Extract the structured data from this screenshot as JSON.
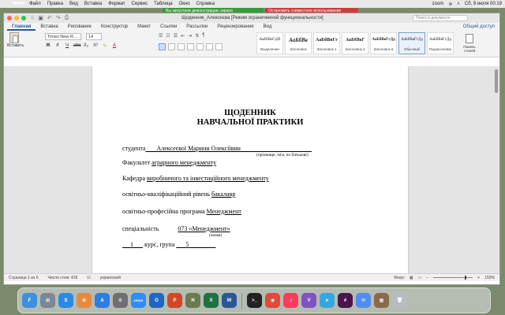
{
  "menubar": {
    "app_name": "Word",
    "items": [
      "Файл",
      "Правка",
      "Вид",
      "Вставка",
      "Формат",
      "Сервис",
      "Таблица",
      "Окно",
      "Справка"
    ],
    "zoom_label": "zoom",
    "clock": "Сб, 8 июля 00:19"
  },
  "banners": {
    "demo": "Вы запустили демонстрацию экрана",
    "stop": "Остановить совместное использование"
  },
  "window": {
    "title": "Щоденник_Алексеєва [Режим ограниченной функциональности]",
    "search_placeholder": "Поиск в документе"
  },
  "tabs": [
    "Главная",
    "Вставка",
    "Рисование",
    "Конструктор",
    "Макет",
    "Ссылки",
    "Рассылки",
    "Рецензирование",
    "Вид"
  ],
  "active_tab": "Главная",
  "share_label": "Общий доступ",
  "ribbon": {
    "paste_label": "Вставить",
    "font_name": "Times New R...",
    "font_size": "14",
    "styles": [
      {
        "sample": "АаБбВвГгДд",
        "name": "Выделение"
      },
      {
        "sample": "АаБбВв",
        "name": "Заголовок"
      },
      {
        "sample": "АаБбВвГг",
        "name": "Заголовок 1"
      },
      {
        "sample": "АаБбВвГ",
        "name": "Заголовок 2"
      },
      {
        "sample": "АаБбВвГгДд",
        "name": "Заголовок 6"
      },
      {
        "sample": "АаБбВвГгДд",
        "name": "Обычный"
      },
      {
        "sample": "АаБбВвГгДд",
        "name": "Подзаголовок"
      }
    ],
    "selected_style": "Обычный",
    "styles_pane_label": "Панель стилей"
  },
  "document": {
    "title_line1": "ЩОДЕННИК",
    "title_line2": "НАВЧАЛЬНОЇ ПРАКТИКИ",
    "student_label": "студента",
    "student_name": "Алексеєвої Марини Олексіївни",
    "student_hint": "(прізвище, ім'я, по батькові)",
    "faculty_label": "Факультет",
    "faculty_value": "аграрного менеджменту",
    "department_label": "Кафедра",
    "department_value": "виробничого та інвестиційного менеджменту",
    "level_label": "освітньо-кваліфікаційний  рівень",
    "level_value": "бакалавр",
    "program_label": "освітньо-професійна програма",
    "program_value": "Менеджмент",
    "specialty_label": "спеціальність",
    "specialty_value": "073 «Менеджмент»",
    "specialty_hint": "(назва)",
    "course_value": "1",
    "course_label": "курс,  група",
    "group_value": "5"
  },
  "status": {
    "page": "Страница 1 из 6",
    "words": "Число слов: 419",
    "language": "украинский",
    "focus": "Фокус",
    "zoom": "150%"
  },
  "dock_apps": [
    {
      "name": "Finder",
      "label": "F",
      "color": "#3d8fe0"
    },
    {
      "name": "Launchpad",
      "label": "⊞",
      "color": "#7b8796"
    },
    {
      "name": "Safari",
      "label": "S",
      "color": "#2b8ae6"
    },
    {
      "name": "Photos",
      "label": "✿",
      "color": "#e88a3c"
    },
    {
      "name": "App Store",
      "label": "A",
      "color": "#2f7de1"
    },
    {
      "name": "System Preferences",
      "label": "⚙",
      "color": "#6e6e73"
    },
    {
      "name": "zoom",
      "label": "zoom",
      "color": "#2d8cff"
    },
    {
      "name": "Outlook",
      "label": "O",
      "color": "#1d66c4"
    },
    {
      "name": "PowerPoint",
      "label": "P",
      "color": "#d24726"
    },
    {
      "name": "Notes",
      "label": "N",
      "color": "#6b7a50"
    },
    {
      "name": "Excel",
      "label": "X",
      "color": "#1e7145"
    },
    {
      "name": "Word",
      "label": "W",
      "color": "#2b5797"
    },
    {
      "name": "Terminal",
      "label": ">_",
      "color": "#222222"
    },
    {
      "name": "Chrome",
      "label": "◉",
      "color": "#e24a3b"
    },
    {
      "name": "Music",
      "label": "♫",
      "color": "#fa3d5a"
    },
    {
      "name": "Viber",
      "label": "V",
      "color": "#7d54c4"
    },
    {
      "name": "Telegram",
      "label": "➤",
      "color": "#34a7e1"
    },
    {
      "name": "Slack",
      "label": "#",
      "color": "#4a154b"
    },
    {
      "name": "Mail",
      "label": "✉",
      "color": "#4f8ef0"
    },
    {
      "name": "Preview",
      "label": "▦",
      "color": "#8a6a4c"
    },
    {
      "name": "Trash",
      "label": "🗑",
      "color": "#b8bcc2"
    }
  ]
}
